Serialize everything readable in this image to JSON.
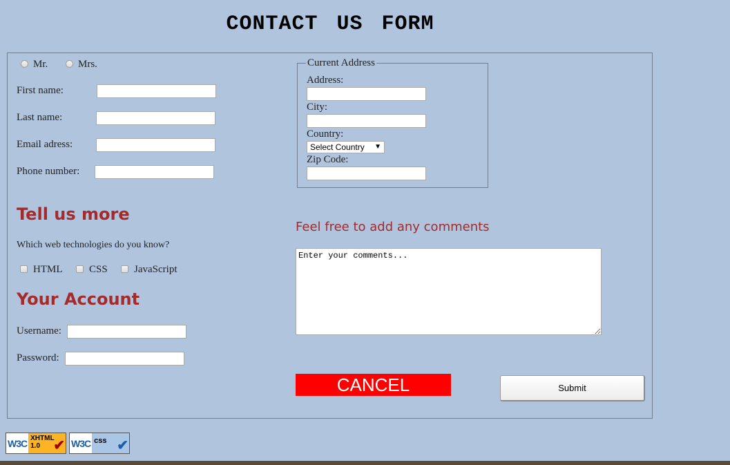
{
  "title": "CONTACT US FORM",
  "personal": {
    "salutations": [
      "Mr.",
      "Mrs."
    ],
    "first_name_label": "First name:",
    "last_name_label": "Last name:",
    "email_label": "Email adress:",
    "phone_label": "Phone number:"
  },
  "address": {
    "legend": "Current Address",
    "address_label": "Address:",
    "city_label": "City:",
    "country_label": "Country:",
    "country_selected": "Select Country",
    "zip_label": "Zip Code:"
  },
  "tell_more": {
    "heading": "Tell us more",
    "question": "Which web technologies do you know?",
    "options": [
      "HTML",
      "CSS",
      "JavaScript"
    ]
  },
  "account": {
    "heading": "Your Account",
    "username_label": "Username:",
    "password_label": "Password:"
  },
  "comments": {
    "heading": "Feel free to add any comments",
    "placeholder": "Enter your comments..."
  },
  "buttons": {
    "cancel": "CANCEL",
    "submit": "Submit"
  },
  "badges": {
    "w3c": "W3C",
    "xhtml_kind": "XHTML",
    "xhtml_version": "1.0",
    "css_kind": "css"
  },
  "colors": {
    "background": "#b0c4de",
    "heading": "#a52a2a",
    "cancel_bg": "#ff0000"
  }
}
